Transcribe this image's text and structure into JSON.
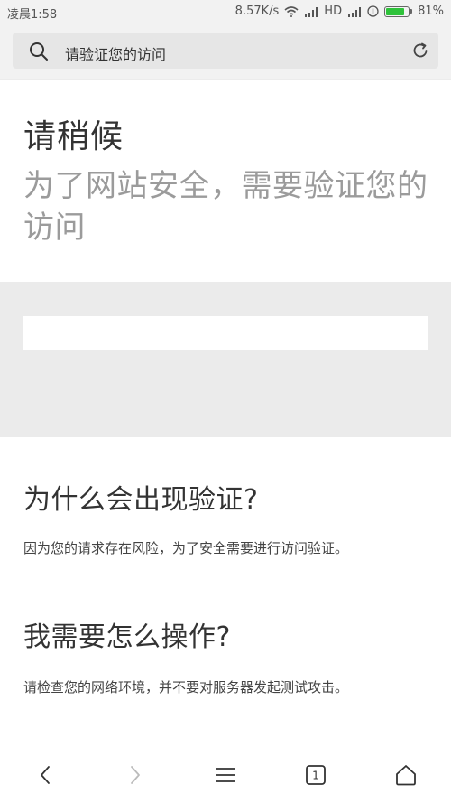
{
  "status_bar": {
    "time": "凌晨1:58",
    "network_speed": "8.57K/s",
    "hd_label": "HD",
    "battery_percent": "81%",
    "battery_level": 0.81,
    "battery_color": "#2ec23a"
  },
  "address_bar": {
    "page_title": "请验证您的访问"
  },
  "hero": {
    "title": "请稍候",
    "subtitle": "为了网站安全，需要验证您的访问"
  },
  "why": {
    "heading": "为什么会出现验证?",
    "body": "因为您的请求存在风险，为了安全需要进行访问验证。"
  },
  "how": {
    "heading": "我需要怎么操作?",
    "body": "请检查您的网络环境，并不要对服务器发起测试攻击。"
  },
  "bottom_nav": {
    "tab_count": "1",
    "icons": [
      "back-icon",
      "forward-icon",
      "menu-icon",
      "tabs-icon",
      "home-icon"
    ]
  }
}
